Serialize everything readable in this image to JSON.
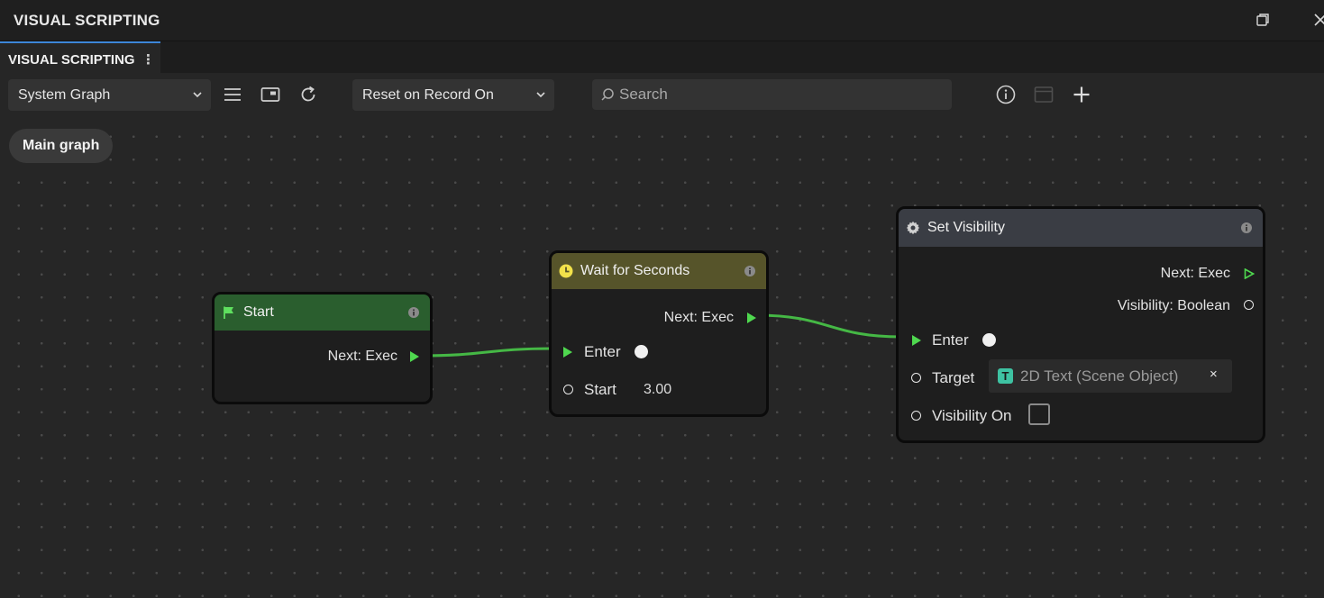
{
  "window": {
    "title": "VISUAL SCRIPTING",
    "tab_label": "VISUAL SCRIPTING"
  },
  "toolbar": {
    "graph_select": "System Graph",
    "reset_select": "Reset on Record On",
    "search_placeholder": "Search"
  },
  "canvas": {
    "breadcrumb": "Main graph"
  },
  "nodes": {
    "start": {
      "title": "Start",
      "next_label": "Next: Exec",
      "color": "#2a5e2e"
    },
    "wait": {
      "title": "Wait for Seconds",
      "next_label": "Next: Exec",
      "enter_label": "Enter",
      "start_label": "Start",
      "start_value": "3.00",
      "color": "#56542a"
    },
    "set_visibility": {
      "title": "Set Visibility",
      "next_label": "Next: Exec",
      "visibility_output_label": "Visibility: Boolean",
      "enter_label": "Enter",
      "target_label": "Target",
      "target_value": "2D Text (Scene Object)",
      "target_clear": "×",
      "visibility_on_label": "Visibility On",
      "visibility_on_checked": false,
      "color": "#3a3d44"
    }
  },
  "colors": {
    "wire": "#45b845",
    "exec_pin": "#4fd84f",
    "accent_tab": "#3d86d8",
    "target_icon": "#3ec2a2"
  },
  "icons": {
    "start": "flag-icon",
    "wait": "clock-icon",
    "set_visibility": "gear-icon",
    "target": "text-t-icon"
  }
}
